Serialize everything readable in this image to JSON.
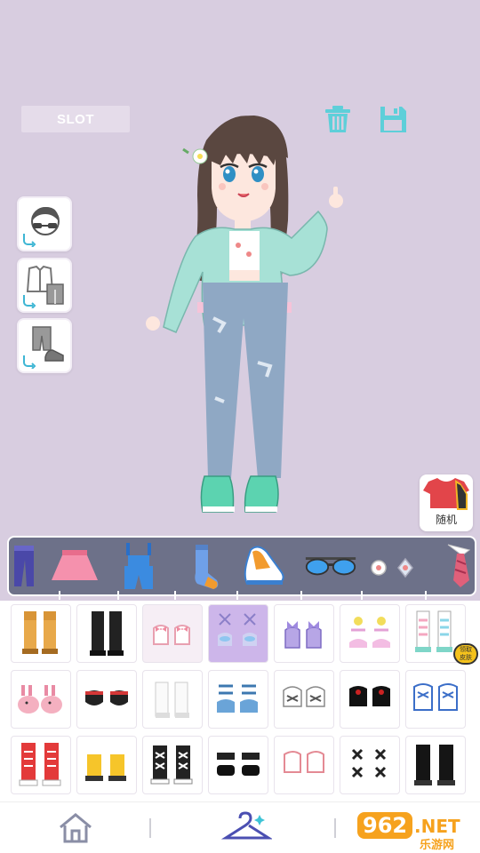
{
  "header": {
    "slot_label": "SLOT",
    "trash_icon": "trash-icon",
    "save_icon": "save-icon"
  },
  "side_buttons": [
    "face-accessory-icon",
    "outfit-icon",
    "pants-shoes-icon"
  ],
  "random_button": {
    "label": "随机",
    "icon": "tshirt-icon"
  },
  "categories": [
    {
      "name": "pants",
      "selected": false
    },
    {
      "name": "skirt",
      "selected": false
    },
    {
      "name": "overalls",
      "selected": false
    },
    {
      "name": "socks",
      "selected": false
    },
    {
      "name": "shoes",
      "selected": true
    },
    {
      "name": "glasses",
      "selected": false
    },
    {
      "name": "earrings",
      "selected": false
    },
    {
      "name": "tie",
      "selected": false
    }
  ],
  "item_badge": "领取皮肤",
  "shoe_items": [
    "tan-boots",
    "black-boots",
    "pink-bow-flats",
    "lavender-heels-selected",
    "purple-bow-shoes",
    "pink-flower-sandals",
    "rainbow-sneakers",
    "bunny-slippers",
    "red-maryjanes",
    "white-boots",
    "blue-sandals",
    "white-sneakers",
    "black-loafers",
    "blue-lace-sneakers",
    "red-high-tops",
    "yellow-high-tops",
    "black-lace-sneakers",
    "black-sandals",
    "pink-sneakers",
    "black-cross-boots",
    "black-ankle-boots"
  ],
  "bottom_nav": [
    "home-icon",
    "wardrobe-hanger-icon"
  ],
  "watermark": {
    "number": "962",
    "suffix": ".NET",
    "sub": "乐游网"
  },
  "colors": {
    "background": "#d8cde0",
    "category_bar": "#6d7189",
    "selected_tile": "#cdb6ea",
    "accent": "#4bc4d6"
  }
}
